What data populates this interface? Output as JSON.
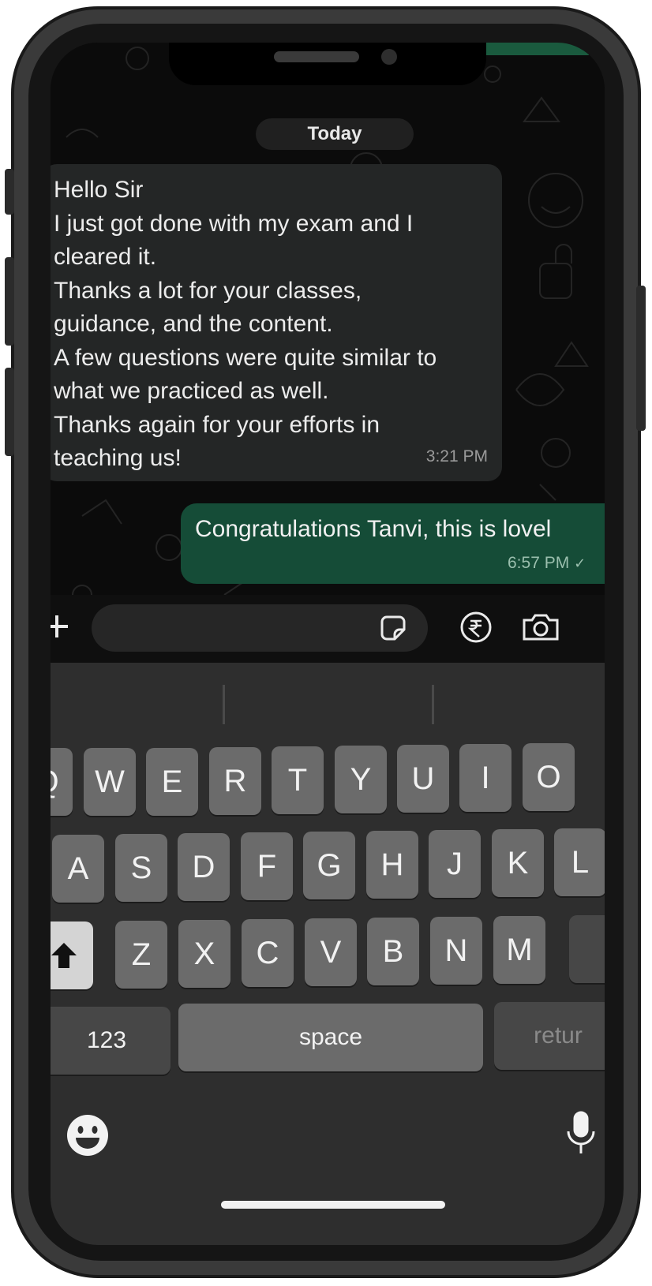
{
  "chat": {
    "date_label": "Today",
    "incoming": {
      "lines": [
        "Hello Sir",
        "I just got done with my exam and I",
        "cleared it.",
        "Thanks a lot for your classes,",
        "guidance, and the content.",
        "A few questions were quite similar to",
        "what we practiced as well.",
        "Thanks again for your efforts in",
        "teaching us!"
      ],
      "time": "3:21 PM"
    },
    "outgoing": {
      "text": "Congratulations Tanvi, this is lovel",
      "time": "6:57 PM"
    }
  },
  "input_bar": {
    "message_placeholder": "",
    "icons": [
      "plus-icon",
      "sticker-icon",
      "rupee-icon",
      "camera-icon"
    ]
  },
  "keyboard": {
    "row1": [
      "Q",
      "W",
      "E",
      "R",
      "T",
      "Y",
      "U",
      "I",
      "O"
    ],
    "row2": [
      "A",
      "S",
      "D",
      "F",
      "G",
      "H",
      "J",
      "K",
      "L"
    ],
    "row3": [
      "Z",
      "X",
      "C",
      "V",
      "B",
      "N",
      "M"
    ],
    "numbers_key": "123",
    "space_key": "space",
    "return_key": "retur",
    "icons": [
      "shift-icon",
      "emoji-icon",
      "microphone-icon"
    ]
  },
  "colors": {
    "outgoing_bubble": "#154c37",
    "incoming_bubble": "#242626",
    "keyboard_bg": "#2e2e2e",
    "key_bg": "#6b6b6b"
  }
}
